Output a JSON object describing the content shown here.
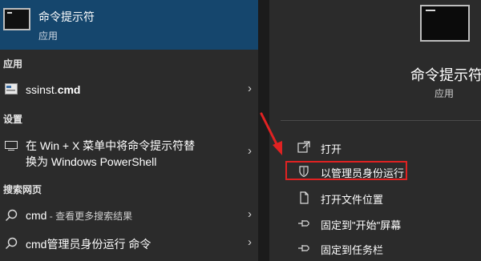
{
  "best_match": {
    "title": "命令提示符",
    "subtitle": "应用"
  },
  "sections": {
    "apps": "应用",
    "settings": "设置",
    "web": "搜索网页"
  },
  "app_item": {
    "label_plain": "ssinst.",
    "label_bold": "cmd"
  },
  "settings_item": {
    "line1": "在 Win + X 菜单中将命令提示符替",
    "line2": "换为 Windows PowerShell"
  },
  "web_items": [
    {
      "query": "cmd",
      "suffix": " - 查看更多搜索结果"
    },
    {
      "query": "cmd管理员身份运行 命令",
      "suffix": ""
    }
  ],
  "chevron": "›",
  "right_panel": {
    "title": "命令提示符",
    "subtitle": "应用",
    "actions": [
      {
        "label": "打开",
        "icon": "open-icon"
      },
      {
        "label": "以管理员身份运行",
        "icon": "shield-icon"
      },
      {
        "label": "打开文件位置",
        "icon": "file-location-icon"
      },
      {
        "label": "固定到\"开始\"屏幕",
        "icon": "pin-icon"
      },
      {
        "label": "固定到任务栏",
        "icon": "pin-icon"
      }
    ]
  },
  "colors": {
    "highlight_border": "#e02222",
    "arrow": "#e02222",
    "selected_bg": "#15466d"
  }
}
